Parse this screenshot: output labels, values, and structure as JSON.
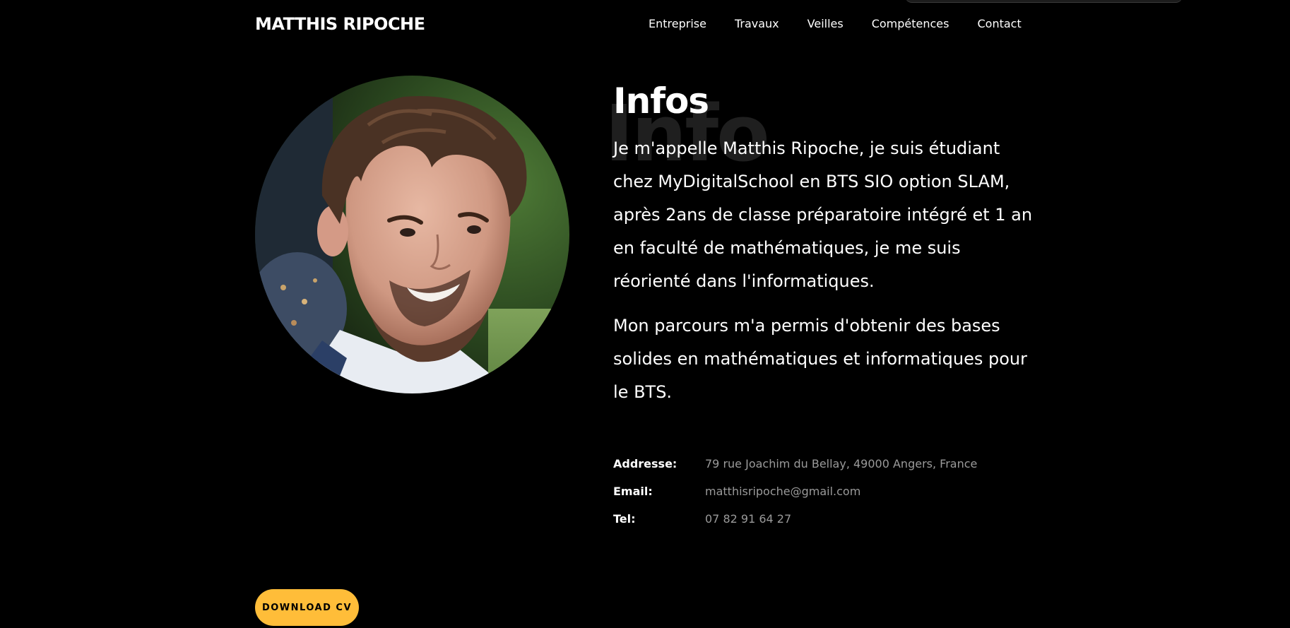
{
  "header": {
    "brand": "MATTHIS RIPOCHE",
    "nav": [
      "Entreprise",
      "Travaux",
      "Veilles",
      "Compétences",
      "Contact"
    ]
  },
  "about": {
    "watermark": "Info",
    "heading": "Infos",
    "paragraphs": [
      "Je m'appelle Matthis Ripoche, je suis étudiant chez MyDigitalSchool en BTS SIO option SLAM, après 2ans de classe préparatoire intégré et 1 an en faculté de mathématiques, je me suis réorienté dans l'informatiques.",
      "Mon parcours m'a permis d'obtenir des bases solides en mathématiques et informatiques pour le BTS."
    ],
    "info": [
      {
        "label": "Addresse:",
        "value": "79 rue Joachim du Bellay, 49000 Angers, France"
      },
      {
        "label": "Email:",
        "value": "matthisripoche@gmail.com"
      },
      {
        "label": "Tel:",
        "value": "07 82 91 64 27"
      }
    ]
  },
  "cv_button": "DOWNLOAD CV",
  "colors": {
    "background": "#000000",
    "accent": "#ffbd39",
    "muted_text": "#9a9a9a",
    "watermark": "#1f1f1f"
  }
}
